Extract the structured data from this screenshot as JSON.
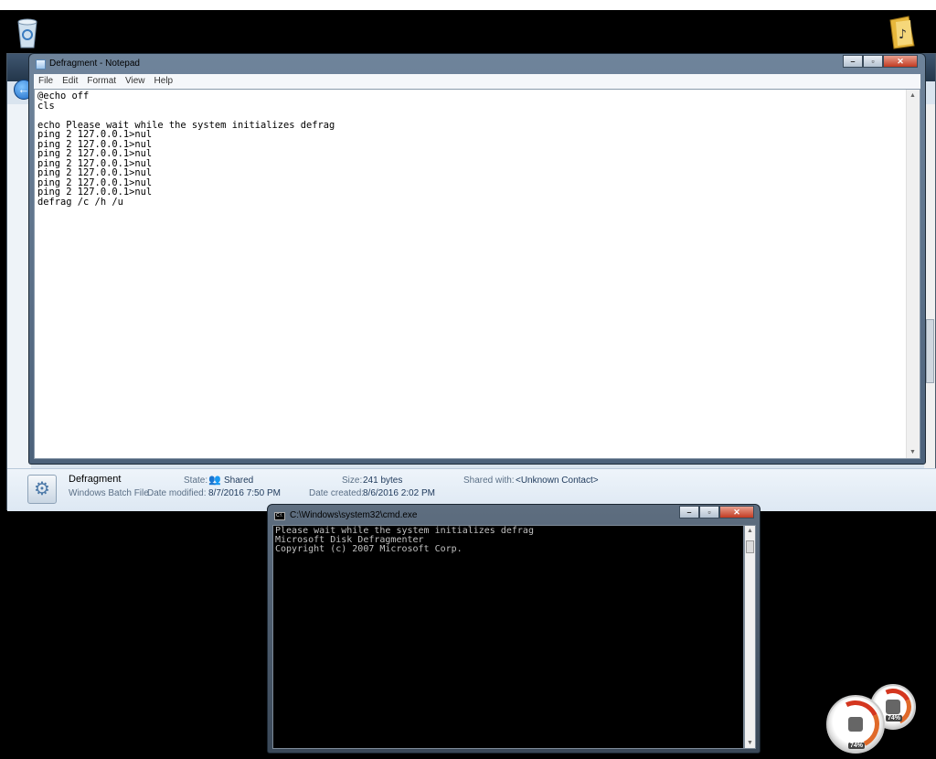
{
  "notepad": {
    "title": "Defragment - Notepad",
    "menu": [
      "File",
      "Edit",
      "Format",
      "View",
      "Help"
    ],
    "content": "@echo off\ncls\n\necho Please wait while the system initializes defrag\nping 2 127.0.0.1>nul\nping 2 127.0.0.1>nul\nping 2 127.0.0.1>nul\nping 2 127.0.0.1>nul\nping 2 127.0.0.1>nul\nping 2 127.0.0.1>nul\nping 2 127.0.0.1>nul\ndefrag /c /h /u"
  },
  "details_pane": {
    "name": "Defragment",
    "type": "Windows Batch File",
    "state_label": "State:",
    "state_value": "Shared",
    "date_modified_label": "Date modified:",
    "date_modified_value": "8/7/2016 7:50 PM",
    "size_label": "Size:",
    "size_value": "241 bytes",
    "date_created_label": "Date created:",
    "date_created_value": "8/6/2016 2:02 PM",
    "shared_with_label": "Shared with:",
    "shared_with_value": "<Unknown Contact>"
  },
  "cmd": {
    "title": "C:\\Windows\\system32\\cmd.exe",
    "output": "Please wait while the system initializes defrag\nMicrosoft Disk Defragmenter\nCopyright (c) 2007 Microsoft Corp."
  },
  "gadget": {
    "cpu_percent": "74%",
    "memory_percent": "74%"
  }
}
